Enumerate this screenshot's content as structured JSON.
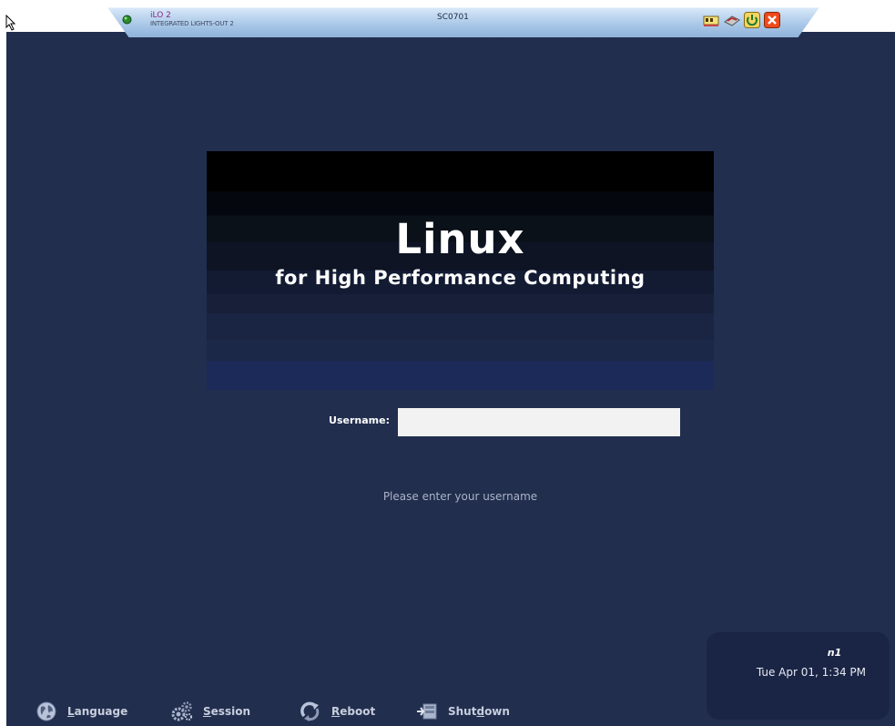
{
  "console_bar": {
    "ilo_name": "iLO 2",
    "ilo_subname": "INTEGRATED LIGHTS-OUT 2",
    "host": "SC0701",
    "icons": [
      "network-icon",
      "keyboard-icon",
      "power-icon",
      "close-icon"
    ],
    "colors": {
      "bar": "#aac8e8",
      "close": "#f04a1a",
      "power": "#2fa03a"
    }
  },
  "banner": {
    "title": "Linux",
    "subtitle": "for High Performance Computing"
  },
  "login": {
    "username_label": "Username:",
    "username_value": "",
    "message": "Please enter your username"
  },
  "clock": {
    "hostname": "n1",
    "datetime": "Tue Apr 01,  1:34 PM"
  },
  "actions": [
    {
      "icon": "globe-icon",
      "label": "Language",
      "mnemonic": "L",
      "rest": "anguage"
    },
    {
      "icon": "gears-icon",
      "label": "Session",
      "mnemonic": "S",
      "rest": "ession"
    },
    {
      "icon": "reboot-icon",
      "label": "Reboot",
      "mnemonic": "R",
      "rest": "eboot"
    },
    {
      "icon": "shutdown-icon",
      "label": "Shutdown",
      "pre": "Shut",
      "mnemonic": "d",
      "rest": "own"
    }
  ],
  "theme": {
    "background": "#212e4e",
    "clock_box": "#1a2545",
    "input": "#f2f2f2"
  }
}
